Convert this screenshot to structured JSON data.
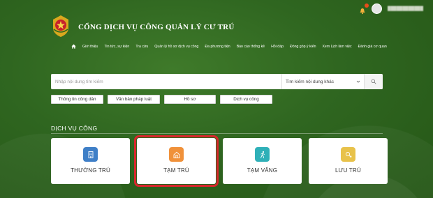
{
  "header": {
    "title": "CỔNG DỊCH VỤ CÔNG QUẢN LÝ CƯ TRÚ"
  },
  "nav": {
    "items": [
      "Giới thiệu",
      "Tin tức, sự kiện",
      "Tra cứu",
      "Quản lý hồ sơ dịch vụ công",
      "Đa phương tiện",
      "Báo cáo thống kê",
      "Hỏi đáp",
      "Đóng góp ý kiến",
      "Xem Lịch làm việc",
      "Đánh giá cơ quan"
    ]
  },
  "search": {
    "placeholder": "Nhập nội dung tìm kiếm",
    "scope_selected": "Tìm kiếm nội dung khác"
  },
  "quick_links": [
    "Thông tin công dân",
    "Văn bản pháp luật",
    "Hồ sơ",
    "Dịch vụ công"
  ],
  "section": {
    "title": "DỊCH VỤ CÔNG"
  },
  "services": [
    {
      "label": "THƯỜNG TRÚ",
      "icon": "building-icon",
      "color": "#3f7fc7"
    },
    {
      "label": "TẠM TRÚ",
      "icon": "house-icon",
      "color": "#f0913a"
    },
    {
      "label": "TẠM VẮNG",
      "icon": "walking-person-icon",
      "color": "#2fb0b8"
    },
    {
      "label": "LƯU TRÚ",
      "icon": "key-icon",
      "color": "#e8c24a"
    }
  ],
  "colors": {
    "background": "#2f6620",
    "highlight": "#d9262c"
  }
}
